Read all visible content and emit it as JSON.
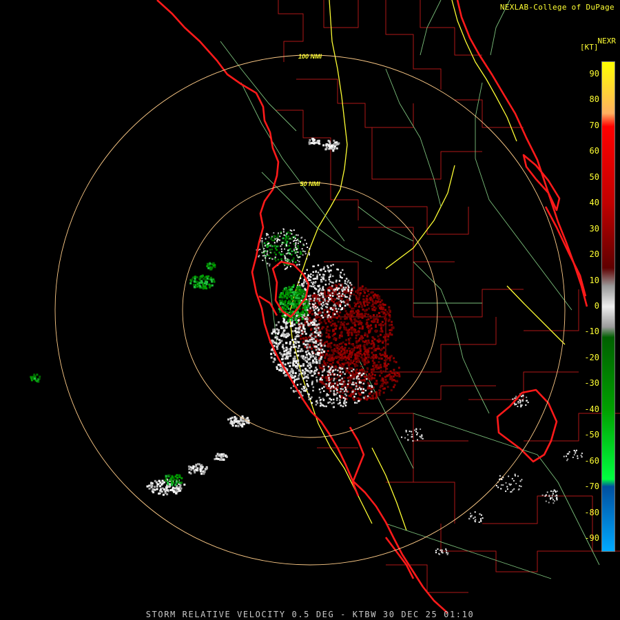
{
  "credit": "NEXLAB-College of DuPage",
  "product": "NEXR",
  "units": "[KT]",
  "caption": "STORM RELATIVE VELOCITY 0.5 DEG - KTBW 30 DEC 25 01:10",
  "range_labels": [
    "100 NMI",
    "50 NMI"
  ],
  "legend": {
    "ticks": [
      "90",
      "80",
      "70",
      "60",
      "50",
      "40",
      "30",
      "20",
      "10",
      "0",
      "-10",
      "-20",
      "-30",
      "-40",
      "-50",
      "-60",
      "-70",
      "-80",
      "-90"
    ],
    "stops": [
      {
        "value": 95,
        "color": "#ffff00"
      },
      {
        "value": 75,
        "color": "#ffb060"
      },
      {
        "value": 70,
        "color": "#ff0000"
      },
      {
        "value": 40,
        "color": "#c00000"
      },
      {
        "value": 15,
        "color": "#600000"
      },
      {
        "value": 8,
        "color": "#9a9a9a"
      },
      {
        "value": 0,
        "color": "#eeeeee"
      },
      {
        "value": -8,
        "color": "#9a9a9a"
      },
      {
        "value": -12,
        "color": "#006000"
      },
      {
        "value": -40,
        "color": "#00a000"
      },
      {
        "value": -67,
        "color": "#00ff40"
      },
      {
        "value": -70,
        "color": "#0050a0"
      },
      {
        "value": -95,
        "color": "#00aaff"
      }
    ]
  },
  "colors": {
    "coast": "#ff1a1a",
    "county": "#b01818",
    "highway": "#ffff33",
    "road": "#7cc07c",
    "range_ring": "#ffcc88"
  }
}
